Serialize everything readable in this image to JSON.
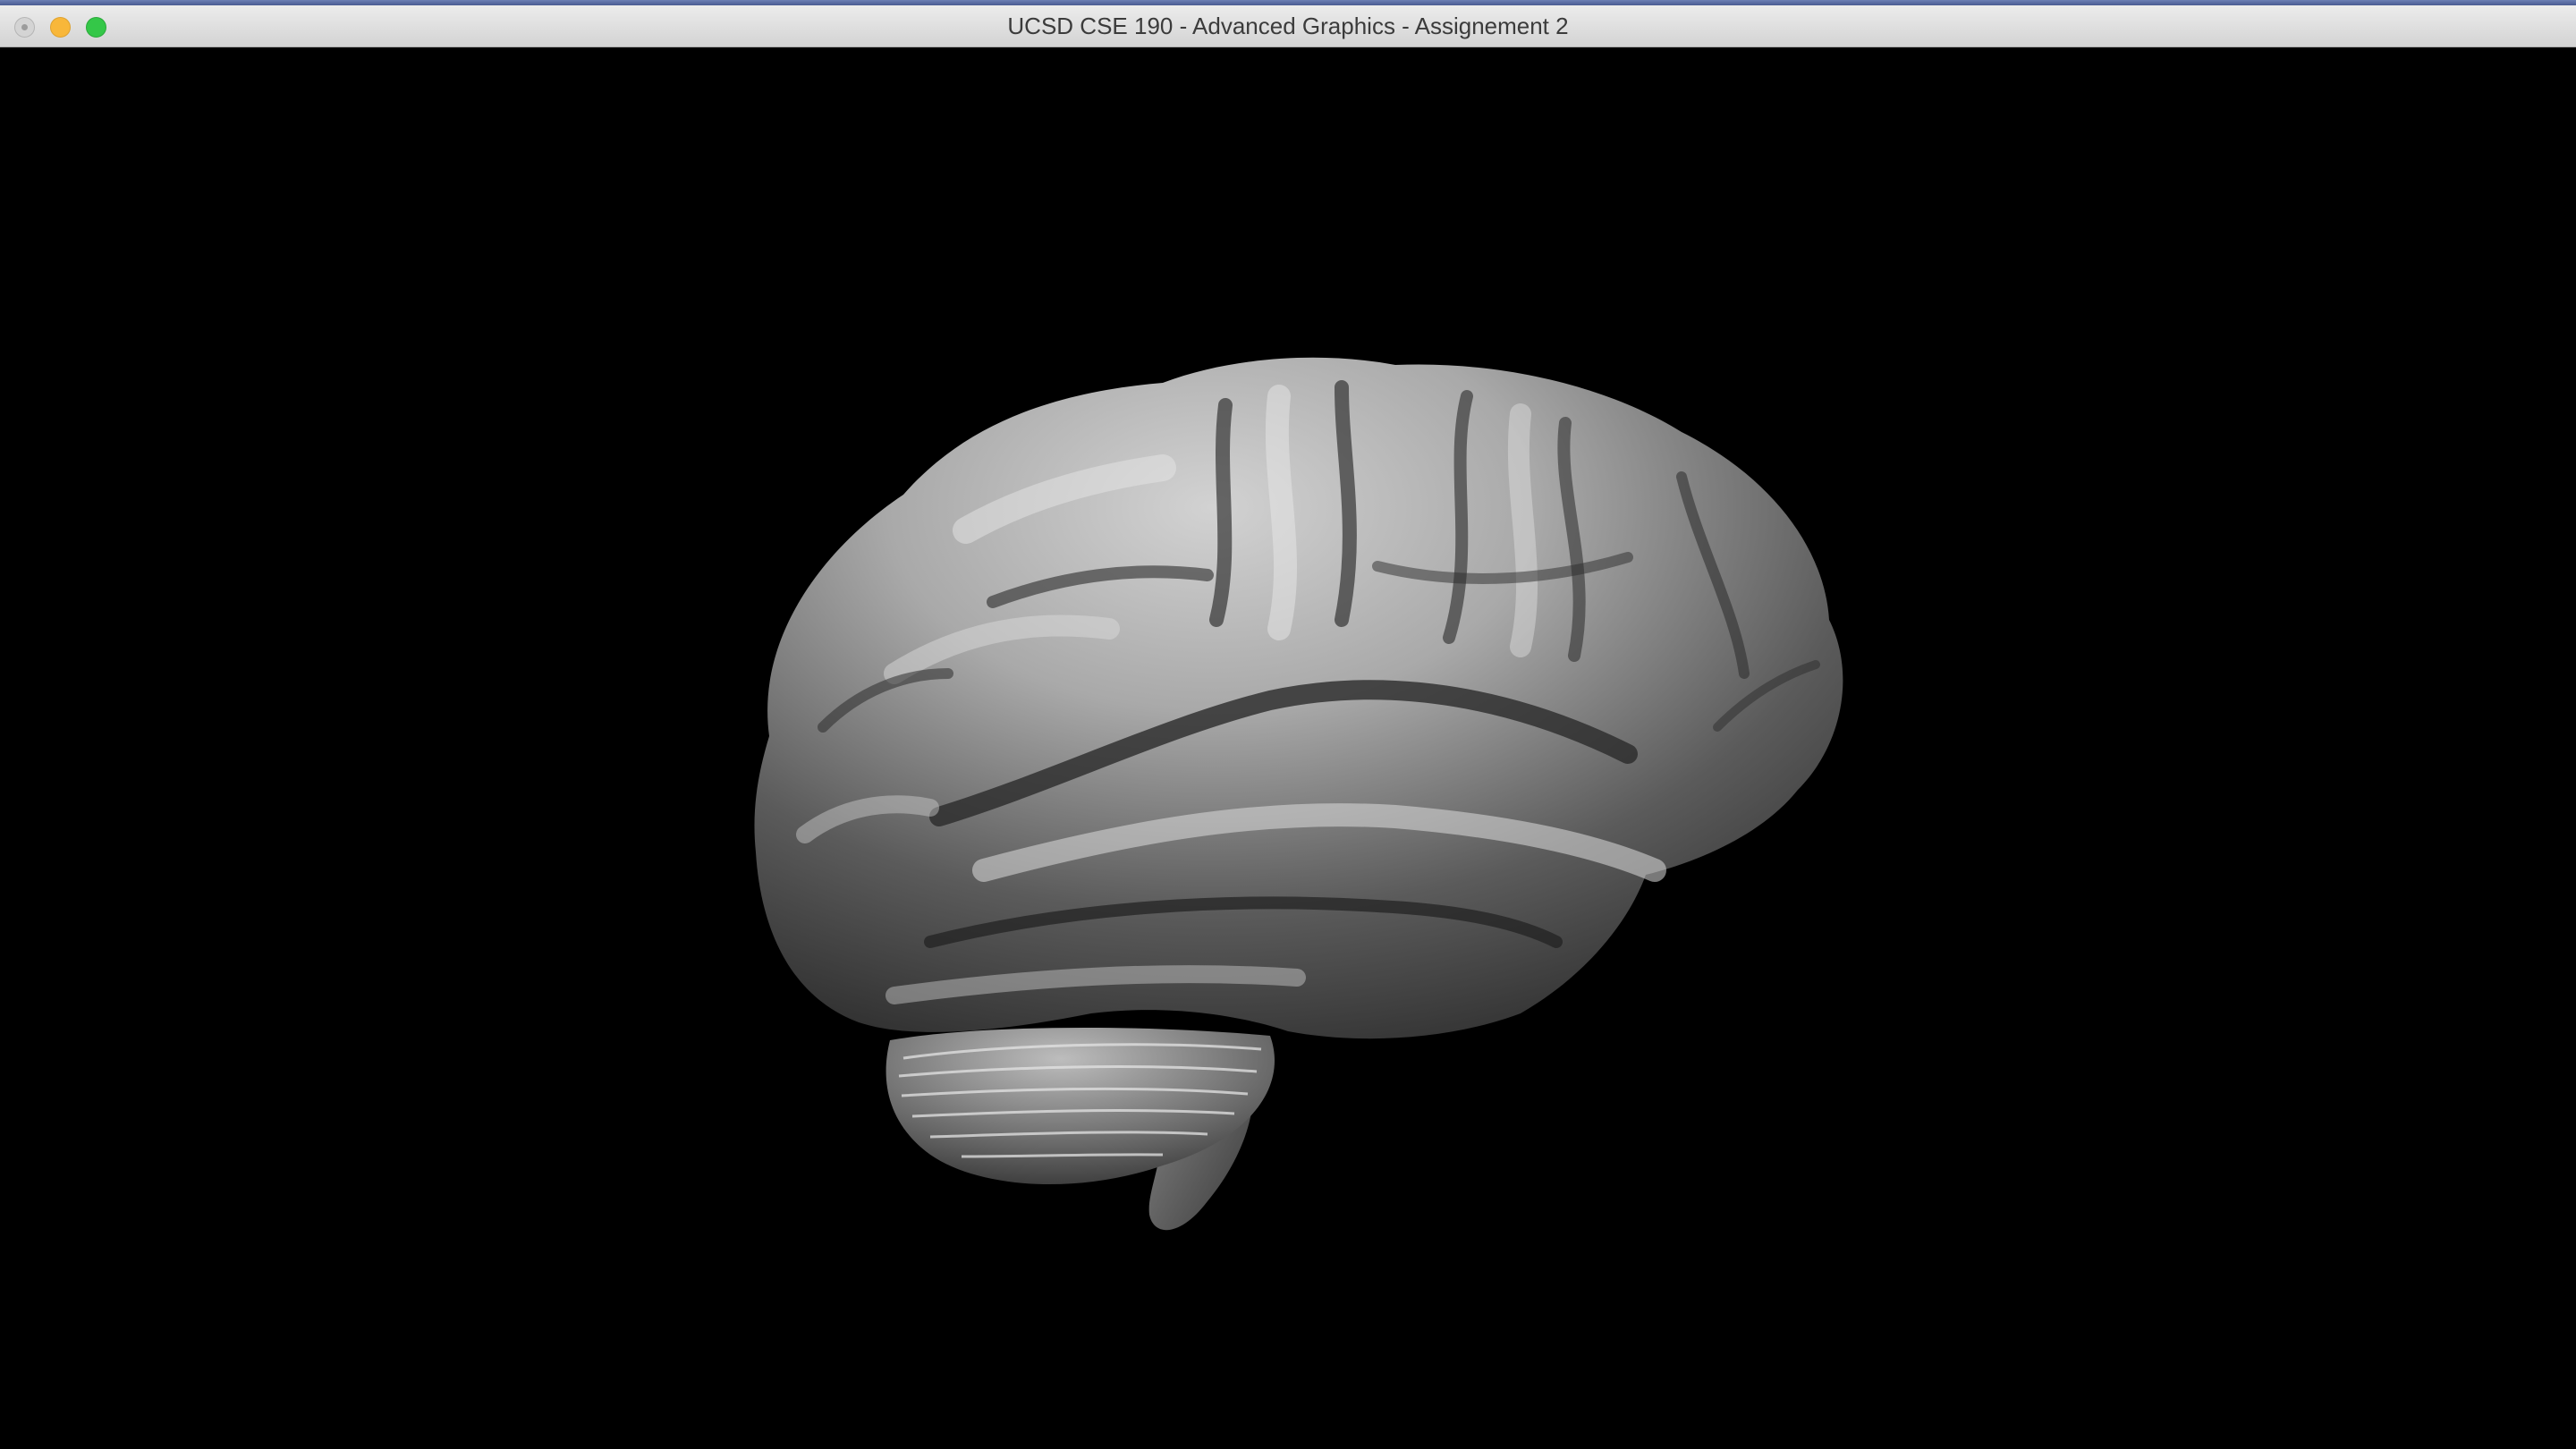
{
  "window": {
    "title": "UCSD CSE 190 - Advanced Graphics - Assignement 2",
    "buttons": [
      "close",
      "minimize",
      "zoom"
    ]
  },
  "viewport": {
    "background": "#000000",
    "model": "brain-3d-model",
    "model_color": "#9a9a9a"
  }
}
